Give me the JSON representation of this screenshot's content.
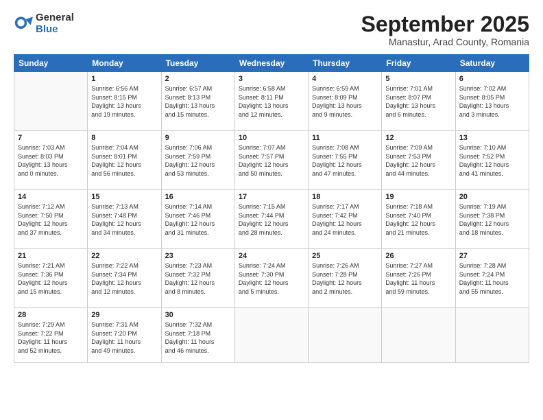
{
  "header": {
    "logo_general": "General",
    "logo_blue": "Blue",
    "month_title": "September 2025",
    "subtitle": "Manastur, Arad County, Romania"
  },
  "weekdays": [
    "Sunday",
    "Monday",
    "Tuesday",
    "Wednesday",
    "Thursday",
    "Friday",
    "Saturday"
  ],
  "weeks": [
    [
      {
        "day": "",
        "info": ""
      },
      {
        "day": "1",
        "info": "Sunrise: 6:56 AM\nSunset: 8:15 PM\nDaylight: 13 hours\nand 19 minutes."
      },
      {
        "day": "2",
        "info": "Sunrise: 6:57 AM\nSunset: 8:13 PM\nDaylight: 13 hours\nand 15 minutes."
      },
      {
        "day": "3",
        "info": "Sunrise: 6:58 AM\nSunset: 8:11 PM\nDaylight: 13 hours\nand 12 minutes."
      },
      {
        "day": "4",
        "info": "Sunrise: 6:59 AM\nSunset: 8:09 PM\nDaylight: 13 hours\nand 9 minutes."
      },
      {
        "day": "5",
        "info": "Sunrise: 7:01 AM\nSunset: 8:07 PM\nDaylight: 13 hours\nand 6 minutes."
      },
      {
        "day": "6",
        "info": "Sunrise: 7:02 AM\nSunset: 8:05 PM\nDaylight: 13 hours\nand 3 minutes."
      }
    ],
    [
      {
        "day": "7",
        "info": "Sunrise: 7:03 AM\nSunset: 8:03 PM\nDaylight: 13 hours\nand 0 minutes."
      },
      {
        "day": "8",
        "info": "Sunrise: 7:04 AM\nSunset: 8:01 PM\nDaylight: 12 hours\nand 56 minutes."
      },
      {
        "day": "9",
        "info": "Sunrise: 7:06 AM\nSunset: 7:59 PM\nDaylight: 12 hours\nand 53 minutes."
      },
      {
        "day": "10",
        "info": "Sunrise: 7:07 AM\nSunset: 7:57 PM\nDaylight: 12 hours\nand 50 minutes."
      },
      {
        "day": "11",
        "info": "Sunrise: 7:08 AM\nSunset: 7:55 PM\nDaylight: 12 hours\nand 47 minutes."
      },
      {
        "day": "12",
        "info": "Sunrise: 7:09 AM\nSunset: 7:53 PM\nDaylight: 12 hours\nand 44 minutes."
      },
      {
        "day": "13",
        "info": "Sunrise: 7:10 AM\nSunset: 7:52 PM\nDaylight: 12 hours\nand 41 minutes."
      }
    ],
    [
      {
        "day": "14",
        "info": "Sunrise: 7:12 AM\nSunset: 7:50 PM\nDaylight: 12 hours\nand 37 minutes."
      },
      {
        "day": "15",
        "info": "Sunrise: 7:13 AM\nSunset: 7:48 PM\nDaylight: 12 hours\nand 34 minutes."
      },
      {
        "day": "16",
        "info": "Sunrise: 7:14 AM\nSunset: 7:46 PM\nDaylight: 12 hours\nand 31 minutes."
      },
      {
        "day": "17",
        "info": "Sunrise: 7:15 AM\nSunset: 7:44 PM\nDaylight: 12 hours\nand 28 minutes."
      },
      {
        "day": "18",
        "info": "Sunrise: 7:17 AM\nSunset: 7:42 PM\nDaylight: 12 hours\nand 24 minutes."
      },
      {
        "day": "19",
        "info": "Sunrise: 7:18 AM\nSunset: 7:40 PM\nDaylight: 12 hours\nand 21 minutes."
      },
      {
        "day": "20",
        "info": "Sunrise: 7:19 AM\nSunset: 7:38 PM\nDaylight: 12 hours\nand 18 minutes."
      }
    ],
    [
      {
        "day": "21",
        "info": "Sunrise: 7:21 AM\nSunset: 7:36 PM\nDaylight: 12 hours\nand 15 minutes."
      },
      {
        "day": "22",
        "info": "Sunrise: 7:22 AM\nSunset: 7:34 PM\nDaylight: 12 hours\nand 12 minutes."
      },
      {
        "day": "23",
        "info": "Sunrise: 7:23 AM\nSunset: 7:32 PM\nDaylight: 12 hours\nand 8 minutes."
      },
      {
        "day": "24",
        "info": "Sunrise: 7:24 AM\nSunset: 7:30 PM\nDaylight: 12 hours\nand 5 minutes."
      },
      {
        "day": "25",
        "info": "Sunrise: 7:26 AM\nSunset: 7:28 PM\nDaylight: 12 hours\nand 2 minutes."
      },
      {
        "day": "26",
        "info": "Sunrise: 7:27 AM\nSunset: 7:26 PM\nDaylight: 11 hours\nand 59 minutes."
      },
      {
        "day": "27",
        "info": "Sunrise: 7:28 AM\nSunset: 7:24 PM\nDaylight: 11 hours\nand 55 minutes."
      }
    ],
    [
      {
        "day": "28",
        "info": "Sunrise: 7:29 AM\nSunset: 7:22 PM\nDaylight: 11 hours\nand 52 minutes."
      },
      {
        "day": "29",
        "info": "Sunrise: 7:31 AM\nSunset: 7:20 PM\nDaylight: 11 hours\nand 49 minutes."
      },
      {
        "day": "30",
        "info": "Sunrise: 7:32 AM\nSunset: 7:18 PM\nDaylight: 11 hours\nand 46 minutes."
      },
      {
        "day": "",
        "info": ""
      },
      {
        "day": "",
        "info": ""
      },
      {
        "day": "",
        "info": ""
      },
      {
        "day": "",
        "info": ""
      }
    ]
  ]
}
